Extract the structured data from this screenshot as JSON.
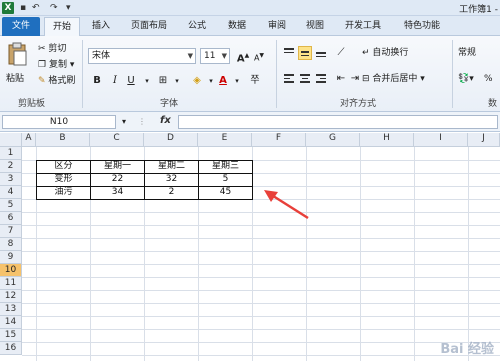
{
  "titlebar": {
    "logo": "X",
    "title": "工作簿1 -"
  },
  "tabs": [
    "文件",
    "开始",
    "插入",
    "页面布局",
    "公式",
    "数据",
    "审阅",
    "视图",
    "开发工具",
    "特色功能"
  ],
  "clipboard": {
    "paste": "粘贴",
    "cut": "剪切",
    "copy": "复制",
    "format_painter": "格式刷",
    "group": "剪贴板"
  },
  "font": {
    "name": "宋体",
    "size": "11",
    "bold": "B",
    "italic": "I",
    "underline": "U",
    "group": "字体"
  },
  "alignment": {
    "wrap": "自动换行",
    "merge": "合并后居中",
    "group": "对齐方式"
  },
  "number": {
    "format": "常规",
    "group_partial": "数"
  },
  "formula_bar": {
    "name_box": "N10",
    "fx": "fx",
    "value": ""
  },
  "columns": [
    "A",
    "B",
    "C",
    "D",
    "E",
    "F",
    "G",
    "H",
    "I",
    "J"
  ],
  "rows": [
    "1",
    "2",
    "3",
    "4",
    "5",
    "6",
    "7",
    "8",
    "9",
    "10",
    "11",
    "12",
    "13",
    "14",
    "15",
    "16"
  ],
  "selected_row": "10",
  "table": {
    "headers": [
      "区分",
      "星期一",
      "星期二",
      "星期三"
    ],
    "rows": [
      [
        "变形",
        "22",
        "32",
        "5"
      ],
      [
        "油污",
        "34",
        "2",
        "45"
      ]
    ]
  },
  "watermark": "Bai 经验",
  "colors": {
    "file_tab": "#1f6fbf",
    "selected_row": "#f6c26b",
    "arrow": "#e8403a"
  }
}
